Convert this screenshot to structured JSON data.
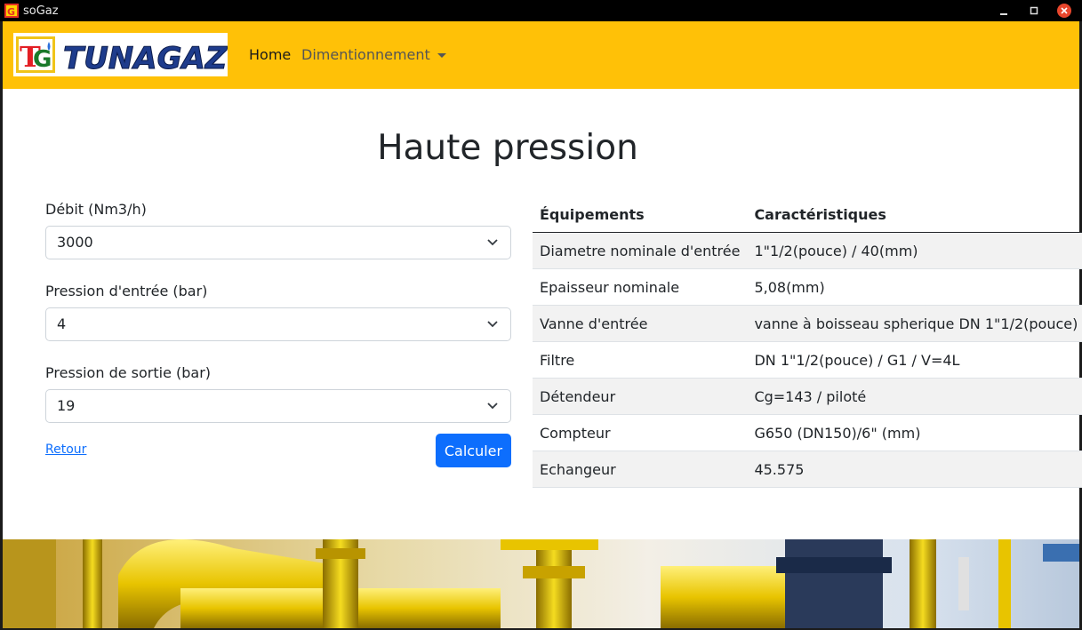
{
  "window": {
    "title": "soGaz"
  },
  "navbar": {
    "logo_text": "TUNAGAZ",
    "home": "Home",
    "dimensionnement": "Dimentionnement"
  },
  "page": {
    "title": "Haute pression",
    "fields": [
      {
        "label": "Débit (Nm3/h)",
        "value": "3000"
      },
      {
        "label": "Pression d'entrée (bar)",
        "value": "4"
      },
      {
        "label": "Pression de sortie (bar)",
        "value": "19"
      }
    ],
    "retour": "Retour",
    "calculer": "Calculer"
  },
  "table": {
    "headers": [
      "Équipements",
      "Caractéristiques"
    ],
    "rows": [
      [
        "Diametre nominale d'entrée",
        "1\"1/2(pouce) / 40(mm)"
      ],
      [
        "Epaisseur nominale",
        "5,08(mm)"
      ],
      [
        "Vanne d'entrée",
        "vanne à boisseau spherique DN 1\"1/2(pouce)"
      ],
      [
        "Filtre",
        "DN 1\"1/2(pouce) / G1 / V=4L"
      ],
      [
        "Détendeur",
        "Cg=143 / piloté"
      ],
      [
        "Compteur",
        "G650 (DN150)/6\" (mm)"
      ],
      [
        "Echangeur",
        "45.575"
      ]
    ]
  },
  "colors": {
    "navbar": "#ffc107",
    "primary": "#0d6efd",
    "window_close": "#e8462c"
  }
}
